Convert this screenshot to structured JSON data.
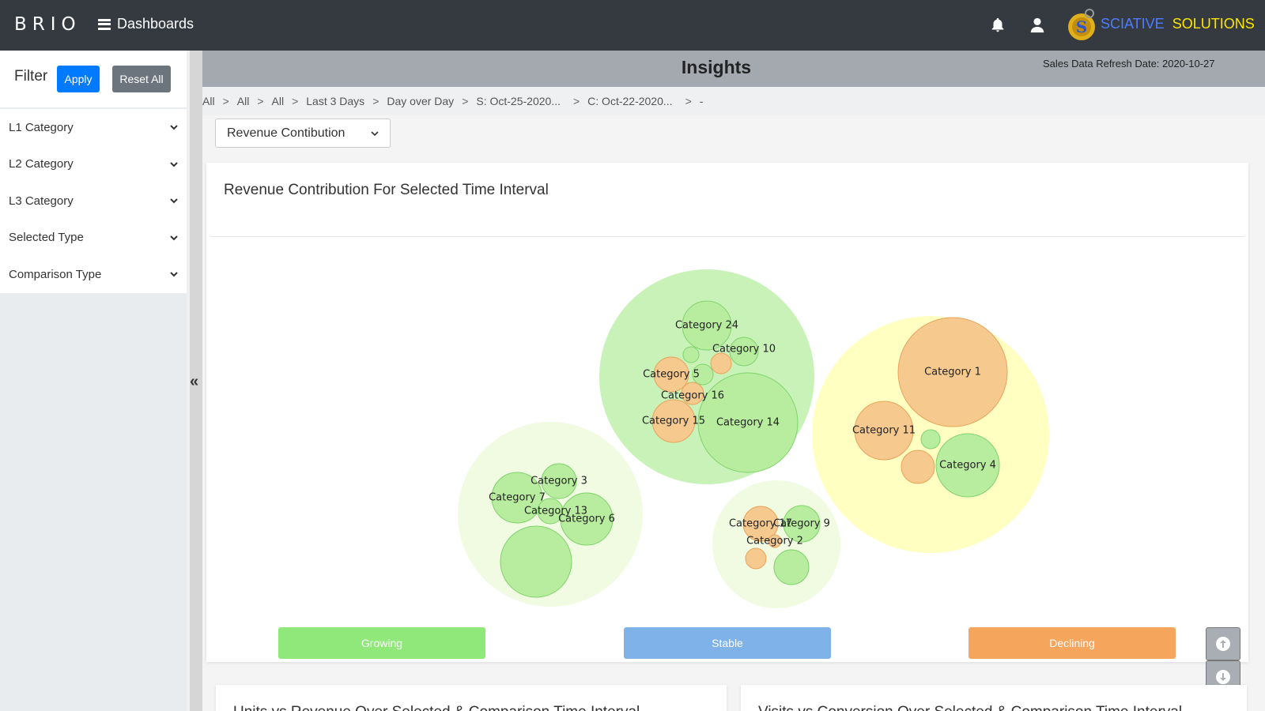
{
  "navbar": {
    "brand": "BRIO",
    "dashboards_label": "Dashboards",
    "company_word1": "SCIATIVE",
    "company_word2": "SOLUTIONS",
    "bell_icon": "bell-icon",
    "user_icon": "user-icon"
  },
  "sidebar": {
    "filter_title": "Filter",
    "apply_label": "Apply",
    "reset_label": "Reset All",
    "items": [
      {
        "label": "L1 Category"
      },
      {
        "label": "L2 Category"
      },
      {
        "label": "L3 Category"
      },
      {
        "label": "Selected Type"
      },
      {
        "label": "Comparison Type"
      }
    ],
    "collapse_glyph": "«"
  },
  "header": {
    "title": "Insights",
    "refresh": "Sales Data Refresh Date: 2020-10-27"
  },
  "breadcrumb": [
    "All",
    "All",
    "All",
    "Last 3 Days",
    "Day over Day",
    "S: Oct-25-2020...",
    "C: Oct-22-2020...",
    "-"
  ],
  "metric_select": {
    "value": "Revenue Contibution"
  },
  "card": {
    "title": "Revenue Contribution For Selected Time Interval"
  },
  "chart_data": {
    "type": "packed-bubble",
    "status_legend": [
      "Growing",
      "Stable",
      "Declining"
    ],
    "colors": {
      "growing": "#90e87b",
      "stable": "#7fb2e8",
      "declining": "#f5a55c",
      "growing_bubble": "#b8ec9e",
      "declining_bubble": "#f6c98f",
      "declining_stroke": "#e9a35a",
      "growing_stroke": "#7ed46b"
    },
    "groups": [
      {
        "id": "group-main",
        "color": "#c8f2b8",
        "members": [
          {
            "label": "Category 24",
            "status": "growing"
          },
          {
            "label": "Category 10",
            "status": "growing"
          },
          {
            "label": "Category 5",
            "status": "declining"
          },
          {
            "label": "Category 16",
            "status": "declining"
          },
          {
            "label": "Category 15",
            "status": "declining"
          },
          {
            "label": "Category 14",
            "status": "growing"
          },
          {
            "label": "",
            "status": "growing"
          },
          {
            "label": "",
            "status": "declining"
          },
          {
            "label": "",
            "status": "growing"
          }
        ]
      },
      {
        "id": "group-right",
        "color": "#ffffc2",
        "members": [
          {
            "label": "Category 1",
            "status": "declining"
          },
          {
            "label": "Category 11",
            "status": "declining"
          },
          {
            "label": "Category 4",
            "status": "growing"
          },
          {
            "label": "",
            "status": "growing"
          },
          {
            "label": "",
            "status": "declining"
          }
        ]
      },
      {
        "id": "group-left",
        "color": "#f1fbe2",
        "members": [
          {
            "label": "Category 3",
            "status": "growing"
          },
          {
            "label": "Category 7",
            "status": "growing"
          },
          {
            "label": "Category 13",
            "status": "growing"
          },
          {
            "label": "Category 6",
            "status": "growing"
          },
          {
            "label": "",
            "status": "growing"
          }
        ]
      },
      {
        "id": "group-small",
        "color": "#f1fbe2",
        "members": [
          {
            "label": "Category 9",
            "status": "growing"
          },
          {
            "label": "Category 17",
            "status": "declining"
          },
          {
            "label": "Category 2",
            "status": "declining"
          },
          {
            "label": "",
            "status": "growing"
          },
          {
            "label": "",
            "status": "declining"
          }
        ]
      }
    ]
  },
  "bottom_cards": [
    {
      "title": "Units vs Revenue Over Selected & Comparison Time Interval"
    },
    {
      "title": "Visits vs Conversion Over Selected & Comparison Time Interval"
    }
  ]
}
